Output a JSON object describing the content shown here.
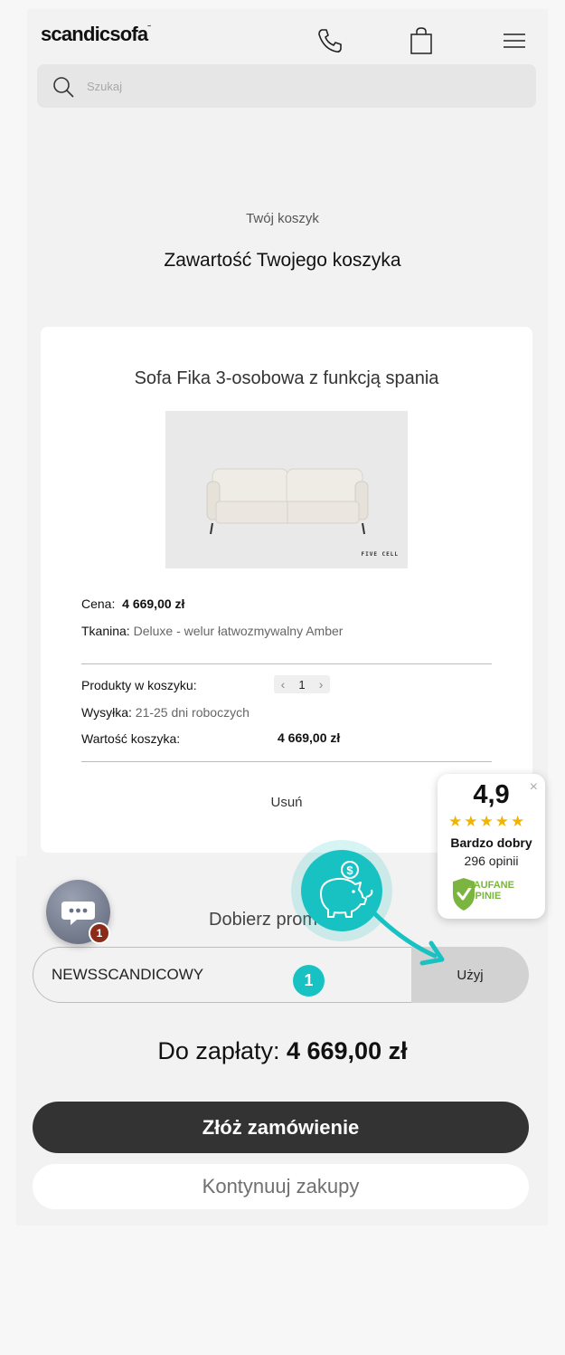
{
  "header": {
    "logo": "scandicsofa",
    "logo_mark": "˜",
    "icons": [
      "phone-icon",
      "cart-icon",
      "menu-icon"
    ]
  },
  "search": {
    "placeholder": "Szukaj"
  },
  "breadcrumb": "Twój koszyk",
  "page_title": "Zawartość Twojego koszyka",
  "product": {
    "title": "Sofa Fika 3-osobowa z funkcją spania",
    "image_brand": "FIVE CELL",
    "price_label": "Cena:",
    "price_value": "4 669,00 zł",
    "fabric_label": "Tkanina:",
    "fabric_value": "Deluxe - welur łatwozmywalny Amber"
  },
  "cart": {
    "products_label": "Produkty w koszyku:",
    "quantity": "1",
    "shipping_label": "Wysyłka:",
    "shipping_value": "21-25 dni roboczych",
    "value_label": "Wartość koszyka:",
    "value_amount": "4 669,00 zł",
    "remove_label": "Usuń"
  },
  "promo": {
    "label": "Dobierz prom",
    "code": "NEWSSCANDICOWY",
    "apply_label": "Użyj",
    "step_number": "1"
  },
  "payment": {
    "label": "Do zapłaty:",
    "amount": "4 669,00 zł",
    "order_label": "Złóż zamówienie",
    "continue_label": "Kontynuuj zakupy"
  },
  "chat": {
    "badge_count": "1"
  },
  "rating_widget": {
    "score": "4,9",
    "stars": 5,
    "label": "Bardzo dobry",
    "count": "296 opinii",
    "trust_line1": "ZAUFANE",
    "trust_line2": "OPINIE"
  },
  "colors": {
    "accent": "#19c2c2",
    "dark": "#333333",
    "star": "#f1b400",
    "trust_green": "#7bb53f",
    "badge": "#8b2b1a"
  }
}
